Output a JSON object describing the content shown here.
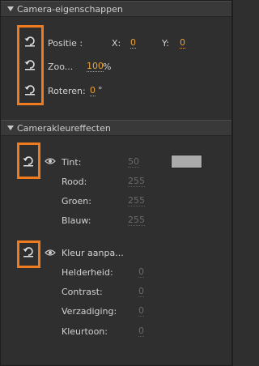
{
  "camera_props": {
    "header": "Camera-eigenschappen",
    "position_label": "Positie :",
    "x_label": "X:",
    "x_value": "0",
    "y_label": "Y:",
    "y_value": "0",
    "zoom_label": "Zoo...",
    "zoom_value": "100",
    "zoom_unit": "%",
    "rotate_label": "Roteren:",
    "rotate_value": "0",
    "rotate_unit": "°"
  },
  "color_effects": {
    "header": "Camerakleureffecten",
    "tint_label": "Tint:",
    "tint_value": "50",
    "tint_color": "#aaaaaa",
    "red_label": "Rood:",
    "red_value": "255",
    "green_label": "Groen:",
    "green_value": "255",
    "blue_label": "Blauw:",
    "blue_value": "255",
    "adjust_label": "Kleur aanpa...",
    "brightness_label": "Helderheid:",
    "brightness_value": "0",
    "contrast_label": "Contrast:",
    "contrast_value": "0",
    "saturation_label": "Verzadiging:",
    "saturation_value": "0",
    "hue_label": "Kleurtoon:",
    "hue_value": "0"
  },
  "colors": {
    "accent_value": "#e8a33a",
    "highlight_box": "#f07b1e",
    "panel_bg": "#2f2f2f"
  },
  "icons": [
    "reset-icon",
    "eye-icon",
    "collapse-triangle-icon"
  ]
}
